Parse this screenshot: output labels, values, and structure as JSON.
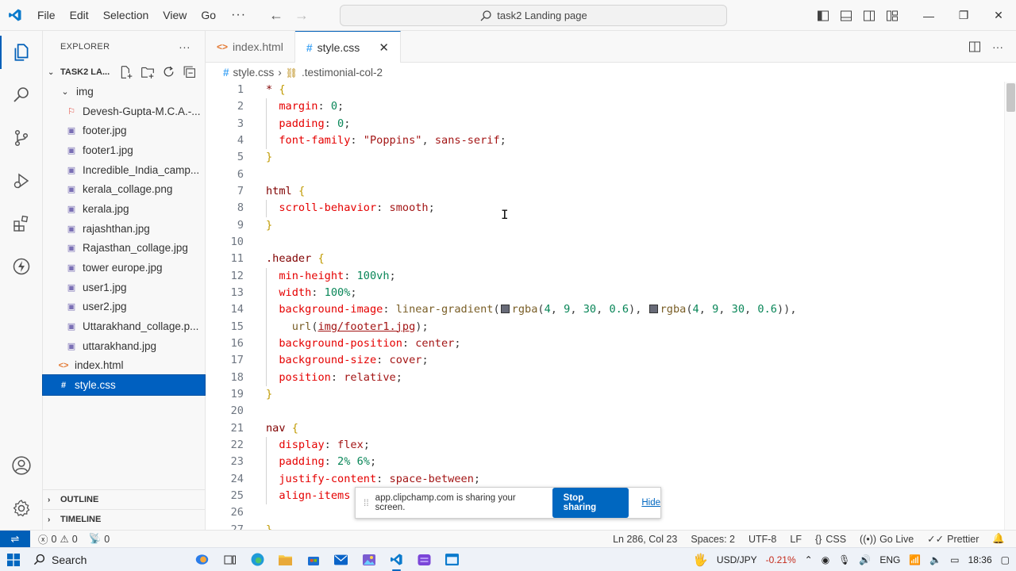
{
  "titlebar": {
    "menu": [
      "File",
      "Edit",
      "Selection",
      "View",
      "Go"
    ],
    "more": "···",
    "search_text": "task2 Landing page"
  },
  "explorer": {
    "title": "EXPLORER",
    "more": "···",
    "folder_name": "TASK2 LA...",
    "subfolder": "img",
    "files": [
      {
        "name": "Devesh-Gupta-M.C.A.-...",
        "icon": "pdf-icon"
      },
      {
        "name": "footer.jpg",
        "icon": "image-icon"
      },
      {
        "name": "footer1.jpg",
        "icon": "image-icon"
      },
      {
        "name": "Incredible_India_camp...",
        "icon": "image-icon"
      },
      {
        "name": "kerala_collage.png",
        "icon": "image-icon"
      },
      {
        "name": "kerala.jpg",
        "icon": "image-icon"
      },
      {
        "name": "rajashthan.jpg",
        "icon": "image-icon"
      },
      {
        "name": "Rajasthan_collage.jpg",
        "icon": "image-icon"
      },
      {
        "name": "tower europe.jpg",
        "icon": "image-icon"
      },
      {
        "name": "user1.jpg",
        "icon": "image-icon"
      },
      {
        "name": "user2.jpg",
        "icon": "image-icon"
      },
      {
        "name": "Uttarakhand_collage.p...",
        "icon": "image-icon"
      },
      {
        "name": "uttarakhand.jpg",
        "icon": "image-icon"
      }
    ],
    "root_files": [
      {
        "name": "index.html",
        "icon": "html-icon"
      },
      {
        "name": "style.css",
        "icon": "css-icon",
        "selected": true
      }
    ],
    "outline": "OUTLINE",
    "timeline": "TIMELINE"
  },
  "tabs": [
    {
      "label": "index.html",
      "icon": "html-icon",
      "active": false
    },
    {
      "label": "style.css",
      "icon": "css-icon",
      "active": true
    }
  ],
  "breadcrumbs": {
    "file": "style.css",
    "symbol": ".testimonial-col-2"
  },
  "code_lines": [
    {
      "n": "1",
      "html": "<span class='tok-sel'>*</span> <span class='tok-br'>{</span>"
    },
    {
      "n": "2",
      "html": "  <span class='tok-prop'>margin</span>: <span class='tok-num'>0</span>;"
    },
    {
      "n": "3",
      "html": "  <span class='tok-prop'>padding</span>: <span class='tok-num'>0</span>;"
    },
    {
      "n": "4",
      "html": "  <span class='tok-prop'>font-family</span>: <span class='tok-str'>\"Poppins\"</span>, <span class='tok-str'>sans-serif</span>;"
    },
    {
      "n": "5",
      "html": "<span class='tok-br'>}</span>"
    },
    {
      "n": "6",
      "html": ""
    },
    {
      "n": "7",
      "html": "<span class='tok-sel'>html</span> <span class='tok-br'>{</span>"
    },
    {
      "n": "8",
      "html": "  <span class='tok-prop'>scroll-behavior</span>: <span class='tok-str'>smooth</span>;"
    },
    {
      "n": "9",
      "html": "<span class='tok-br'>}</span>"
    },
    {
      "n": "10",
      "html": ""
    },
    {
      "n": "11",
      "html": "<span class='tok-sel'>.header</span> <span class='tok-br'>{</span>"
    },
    {
      "n": "12",
      "html": "  <span class='tok-prop'>min-height</span>: <span class='tok-num'>100vh</span>;"
    },
    {
      "n": "13",
      "html": "  <span class='tok-prop'>width</span>: <span class='tok-num'>100%</span>;"
    },
    {
      "n": "14",
      "html": "  <span class='tok-prop'>background-image</span>: <span class='tok-fn'>linear-gradient</span>(<span class='swatch'></span><span class='tok-fn'>rgba</span>(<span class='tok-num'>4</span>, <span class='tok-num'>9</span>, <span class='tok-num'>30</span>, <span class='tok-num'>0.6</span>), <span class='swatch'></span><span class='tok-fn'>rgba</span>(<span class='tok-num'>4</span>, <span class='tok-num'>9</span>, <span class='tok-num'>30</span>, <span class='tok-num'>0.6</span>)),"
    },
    {
      "n": "15",
      "html": "    <span class='tok-fn'>url</span>(<span class='tok-url'>img/footer1.jpg</span>);"
    },
    {
      "n": "16",
      "html": "  <span class='tok-prop'>background-position</span>: <span class='tok-str'>center</span>;"
    },
    {
      "n": "17",
      "html": "  <span class='tok-prop'>background-size</span>: <span class='tok-str'>cover</span>;"
    },
    {
      "n": "18",
      "html": "  <span class='tok-prop'>position</span>: <span class='tok-str'>relative</span>;"
    },
    {
      "n": "19",
      "html": "<span class='tok-br'>}</span>"
    },
    {
      "n": "20",
      "html": ""
    },
    {
      "n": "21",
      "html": "<span class='tok-sel'>nav</span> <span class='tok-br'>{</span>"
    },
    {
      "n": "22",
      "html": "  <span class='tok-prop'>display</span>: <span class='tok-str'>flex</span>;"
    },
    {
      "n": "23",
      "html": "  <span class='tok-prop'>padding</span>: <span class='tok-num'>2%</span> <span class='tok-num'>6%</span>;"
    },
    {
      "n": "24",
      "html": "  <span class='tok-prop'>justify-content</span>: <span class='tok-str'>space-between</span>;"
    },
    {
      "n": "25",
      "html": "  <span class='tok-prop'>align-items</span>"
    },
    {
      "n": "26",
      "html": ""
    },
    {
      "n": "27",
      "html": "<span class='tok-br'>}</span>"
    }
  ],
  "share_popup": {
    "message": "app.clipchamp.com is sharing your screen.",
    "stop": "Stop sharing",
    "hide": "Hide"
  },
  "statusbar": {
    "errors": "0",
    "warnings": "0",
    "ports": "0",
    "position": "Ln 286, Col 23",
    "spaces": "Spaces: 2",
    "encoding": "UTF-8",
    "eol": "LF",
    "language": "CSS",
    "golive": "Go Live",
    "prettier": "Prettier"
  },
  "taskbar": {
    "search": "Search",
    "ticker": "USD/JPY",
    "ticker_change": "-0.21%",
    "lang": "ENG",
    "time": "18:36"
  },
  "colors": {
    "accent": "#005fb8",
    "selection": "#0060c0",
    "stop_button": "#0067c0"
  }
}
